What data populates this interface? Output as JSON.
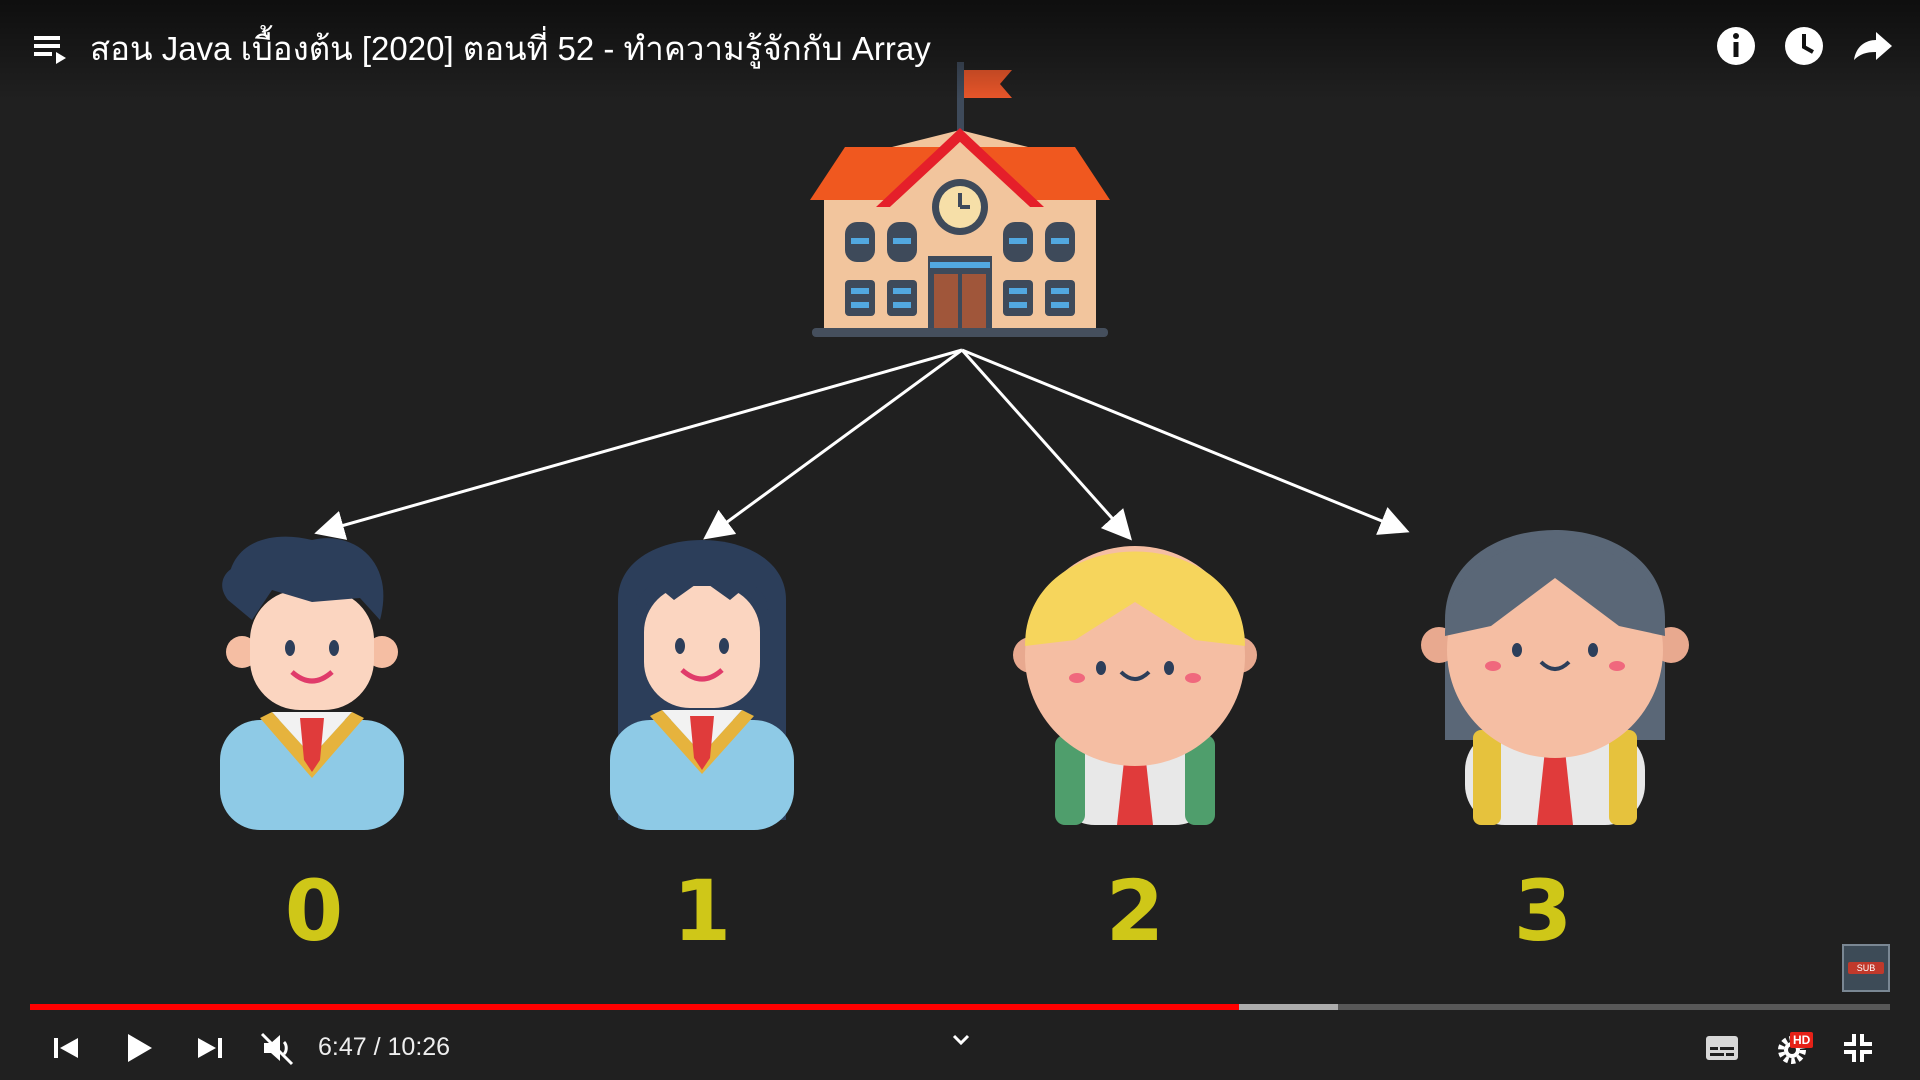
{
  "video": {
    "title": "สอน Java เบื้องต้น [2020] ตอนที่ 52 - ทำความรู้จักกับ Array"
  },
  "diagram": {
    "indices": [
      "0",
      "1",
      "2",
      "3"
    ],
    "index_color": "#cfc718"
  },
  "player": {
    "time_current": "6:47",
    "time_separator": " / ",
    "time_duration": "10:26",
    "progress_fraction": 0.65,
    "buffered_fraction": 0.703,
    "hd_badge": "HD",
    "watermark_text": "SUB",
    "accent_color": "#ff0000"
  },
  "icons": {
    "top": [
      "playlist-icon",
      "info-icon",
      "clock-icon",
      "share-icon"
    ],
    "bottom": [
      "previous-icon",
      "play-icon",
      "next-icon",
      "muted-volume-icon",
      "chevron-down-icon",
      "subtitles-icon",
      "settings-icon",
      "exit-fullscreen-icon"
    ]
  }
}
